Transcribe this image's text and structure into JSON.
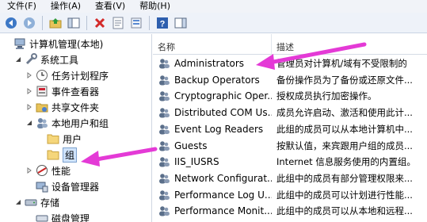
{
  "menu": [
    "文件(F)",
    "操作(A)",
    "查看(V)",
    "帮助(H)"
  ],
  "tree": [
    {
      "label": "计算机管理(本地)",
      "icon": "computer-icon",
      "indent": 0,
      "expander": ""
    },
    {
      "label": "系统工具",
      "icon": "tools-icon",
      "indent": 1,
      "expander": "expanded"
    },
    {
      "label": "任务计划程序",
      "icon": "clock-icon",
      "indent": 2,
      "expander": "collapsed"
    },
    {
      "label": "事件查看器",
      "icon": "event-viewer-icon",
      "indent": 2,
      "expander": "collapsed"
    },
    {
      "label": "共享文件夹",
      "icon": "shared-folder-icon",
      "indent": 2,
      "expander": "collapsed"
    },
    {
      "label": "本地用户和组",
      "icon": "users-icon",
      "indent": 2,
      "expander": "expanded"
    },
    {
      "label": "用户",
      "icon": "folder-icon",
      "indent": 3,
      "expander": ""
    },
    {
      "label": "组",
      "icon": "folder-icon",
      "indent": 3,
      "expander": "",
      "selected": true
    },
    {
      "label": "性能",
      "icon": "performance-icon",
      "indent": 2,
      "expander": "collapsed"
    },
    {
      "label": "设备管理器",
      "icon": "device-manager-icon",
      "indent": 2,
      "expander": ""
    },
    {
      "label": "存储",
      "icon": "storage-icon",
      "indent": 1,
      "expander": "expanded"
    },
    {
      "label": "磁盘管理",
      "icon": "disk-icon",
      "indent": 2,
      "expander": ""
    }
  ],
  "list": {
    "columns": {
      "name": "名称",
      "description": "描述"
    },
    "rows": [
      {
        "name": "Administrators",
        "description": "管理员对计算机/域有不受限制的"
      },
      {
        "name": "Backup Operators",
        "description": "备份操作员为了备份或还原文件..."
      },
      {
        "name": "Cryptographic Oper...",
        "description": "授权成员执行加密操作。"
      },
      {
        "name": "Distributed COM Us...",
        "description": "成员允许启动、激活和使用此计..."
      },
      {
        "name": "Event Log Readers",
        "description": "此组的成员可以从本地计算机中..."
      },
      {
        "name": "Guests",
        "description": "按默认值，来宾跟用户组的成员..."
      },
      {
        "name": "IIS_IUSRS",
        "description": "Internet 信息服务使用的内置组。"
      },
      {
        "name": "Network Configurat...",
        "description": "此组中的成员有部分管理权限来..."
      },
      {
        "name": "Performance Log U...",
        "description": "此组中的成员可以计划进行性能..."
      },
      {
        "name": "Performance Monit...",
        "description": "此组中的成员可以从本地和远程..."
      }
    ]
  },
  "colors": {
    "arrow": "#e43ad6",
    "selection": "#cfe3fb",
    "group_icon": "#5b6f8a"
  }
}
